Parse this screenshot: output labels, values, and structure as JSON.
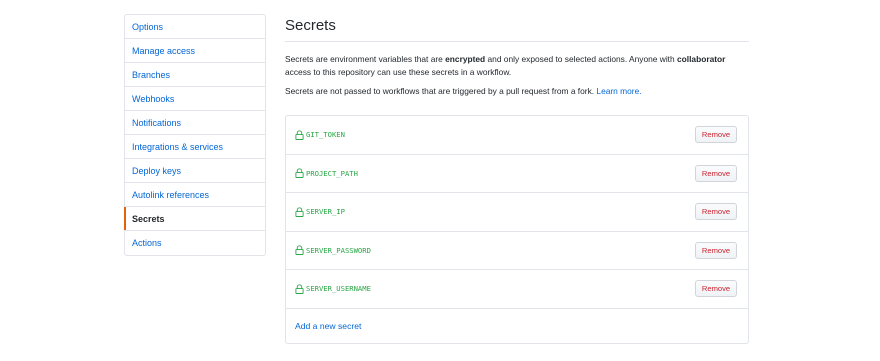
{
  "sidebar": {
    "items": [
      {
        "label": "Options",
        "active": false
      },
      {
        "label": "Manage access",
        "active": false
      },
      {
        "label": "Branches",
        "active": false
      },
      {
        "label": "Webhooks",
        "active": false
      },
      {
        "label": "Notifications",
        "active": false
      },
      {
        "label": "Integrations & services",
        "active": false
      },
      {
        "label": "Deploy keys",
        "active": false
      },
      {
        "label": "Autolink references",
        "active": false
      },
      {
        "label": "Secrets",
        "active": true
      },
      {
        "label": "Actions",
        "active": false
      }
    ]
  },
  "main": {
    "title": "Secrets",
    "description": {
      "part1": "Secrets are environment variables that are ",
      "bold1": "encrypted",
      "part2": " and only exposed to selected actions. Anyone with ",
      "bold2": "collaborator",
      "part3": " access to this repository can use these secrets in a workflow."
    },
    "note": {
      "text": "Secrets are not passed to workflows that are triggered by a pull request from a fork. ",
      "link": "Learn more."
    },
    "secrets": [
      {
        "name": "GIT_TOKEN",
        "action": "Remove"
      },
      {
        "name": "PROJECT_PATH",
        "action": "Remove"
      },
      {
        "name": "SERVER_IP",
        "action": "Remove"
      },
      {
        "name": "SERVER_PASSWORD",
        "action": "Remove"
      },
      {
        "name": "SERVER_USERNAME",
        "action": "Remove"
      }
    ],
    "add_link": "Add a new secret"
  },
  "colors": {
    "link": "#0366d6",
    "secret_name": "#28a745",
    "remove": "#cb2431",
    "active_marker": "#e36209"
  }
}
